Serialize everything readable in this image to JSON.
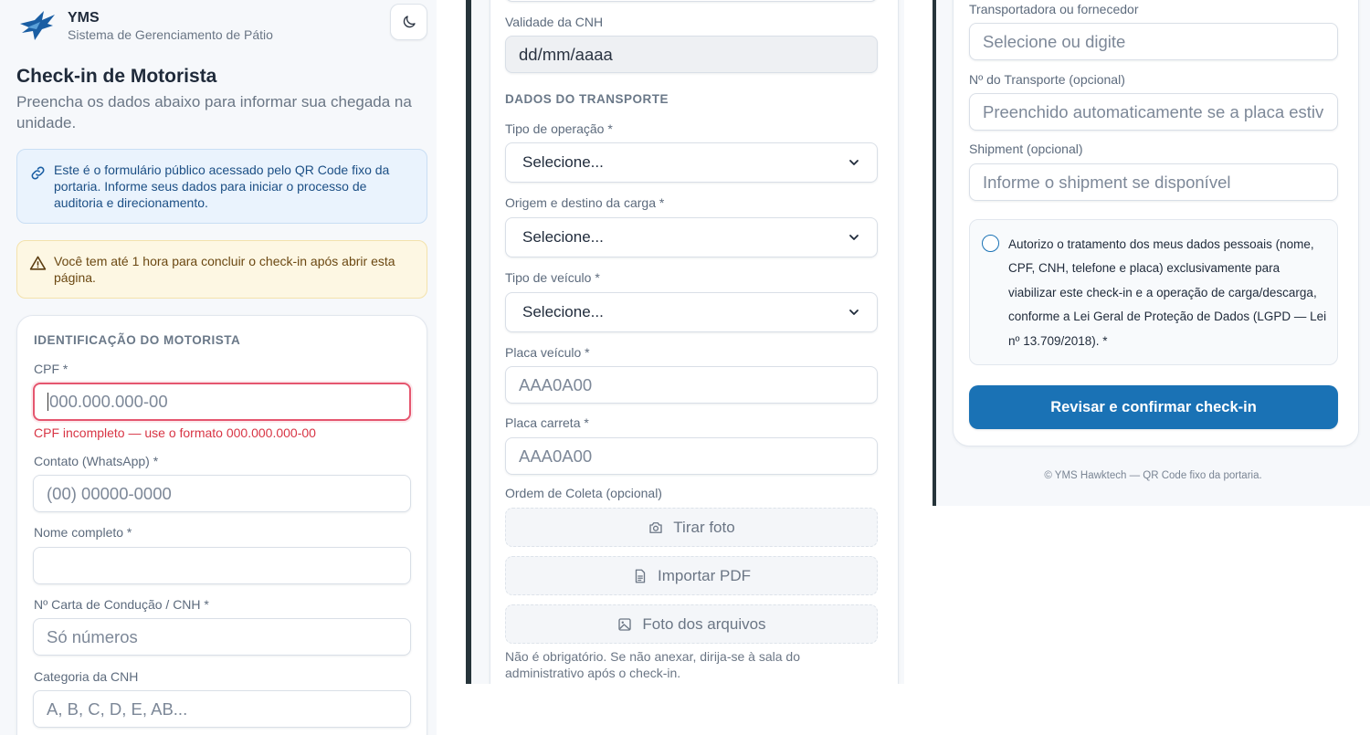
{
  "header": {
    "app_name": "YMS",
    "app_subtitle": "Sistema de Gerenciamento de Pátio",
    "theme_toggle_icon": "moon-icon",
    "logo_icon": "hawk-logo-icon"
  },
  "page": {
    "title": "Check-in de Motorista",
    "subtitle": "Preencha os dados abaixo para informar sua chegada na unidade."
  },
  "info_box": {
    "icon": "link-icon",
    "text": "Este é o formulário público acessado pelo QR Code fixo da portaria. Informe seus dados para iniciar o processo de auditoria e direcionamento."
  },
  "warning_box": {
    "icon": "warning-triangle-icon",
    "text": "Você tem até 1 hora para concluir o check-in após abrir esta página."
  },
  "driver": {
    "section_title": "IDENTIFICAÇÃO DO MOTORISTA",
    "cpf_label": "CPF *",
    "cpf_placeholder": "000.000.000-00",
    "cpf_error": "CPF incompleto — use o formato 000.000.000-00",
    "contact_label": "Contato (WhatsApp) *",
    "contact_placeholder": "(00) 00000-0000",
    "name_label": "Nome completo *",
    "name_value": "",
    "cnh_label": "Nº Carta de Condução / CNH *",
    "cnh_placeholder": "Só números",
    "category_label": "Categoria da CNH",
    "category_placeholder": "A, B, C, D, E, AB...",
    "validity_label": "Validade da CNH",
    "validity_value": "dd/mm/aaaa"
  },
  "transport": {
    "section_title": "DADOS DO TRANSPORTE",
    "operation_label": "Tipo de operação *",
    "operation_value": "Selecione...",
    "origin_label": "Origem e destino da carga *",
    "origin_value": "Selecione...",
    "vehicle_type_label": "Tipo de veículo *",
    "vehicle_type_value": "Selecione...",
    "plate_label": "Placa veículo *",
    "plate_placeholder": "AAA0A00",
    "trailer_label": "Placa carreta *",
    "trailer_placeholder": "AAA0A00",
    "order_label": "Ordem de Coleta (opcional)",
    "take_photo": "Tirar foto",
    "import_pdf": "Importar PDF",
    "photo_files": "Foto dos arquivos",
    "attachment_note": "Não é obrigatório. Se não anexar, dirija-se à sala do administrativo após o check-in.",
    "carrier_label": "Transportadora ou fornecedor",
    "carrier_placeholder": "Selecione ou digite",
    "transport_no_label": "Nº do Transporte (opcional)",
    "transport_no_placeholder": "Preenchido automaticamente se a placa estiv",
    "shipment_label": "Shipment (opcional)",
    "shipment_placeholder": "Informe o shipment se disponível"
  },
  "consent": {
    "text": "Autorizo o tratamento dos meus dados pessoais (nome, CPF, CNH, telefone e placa) exclusivamente para viabilizar este check-in e a operação de carga/descarga, conforme a Lei Geral de Proteção de Dados (LGPD — Lei nº 13.709/2018). *",
    "checked": false
  },
  "submit_label": "Revisar e confirmar check-in",
  "footer": "© YMS Hawktech — QR Code fixo da portaria.",
  "colors": {
    "primary": "#1a72b5",
    "error": "#d83545",
    "info_bg": "#eaf3fd",
    "warning_bg": "#fdf7e3",
    "divider": "#26343a"
  }
}
